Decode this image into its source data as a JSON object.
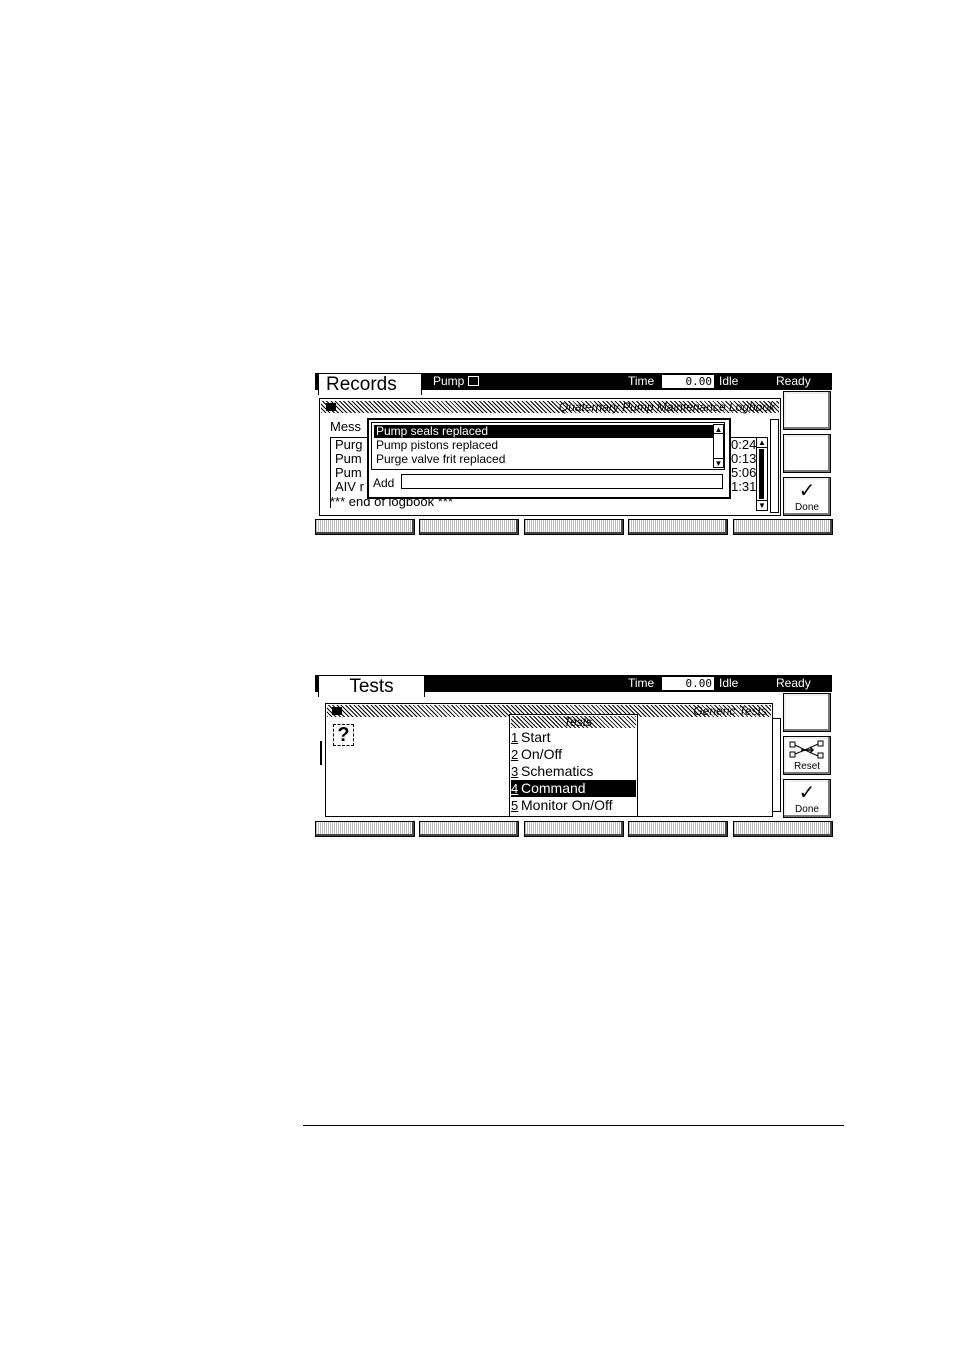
{
  "records_screen": {
    "tab_title": "Records",
    "pump_label": "Pump",
    "time_label": "Time",
    "time_value": "0.00",
    "idle_label": "Idle",
    "status": "Ready",
    "panel_title": "Quaternary Pump Maintenance Logbook",
    "column_header": "Mess",
    "background_rows": [
      "Purg",
      "Pum",
      "Pum",
      "AIV r"
    ],
    "background_times": [
      "0:24",
      "0:13",
      "5:06",
      "1:31"
    ],
    "footer_text": "*** end of logbook ***",
    "popup_items": [
      "Pump seals replaced",
      "Pump pistons replaced",
      "Purge valve frit replaced"
    ],
    "add_label": "Add",
    "add_value": "",
    "done_label": "Done"
  },
  "tests_screen": {
    "tab_title": "Tests",
    "time_label": "Time",
    "time_value": "0.00",
    "idle_label": "Idle",
    "status": "Ready",
    "panel_title": "Generic Tests",
    "help_glyph": "?",
    "menu_title": "Tests",
    "menu_items": [
      {
        "num": "1",
        "label": "Start"
      },
      {
        "num": "2",
        "label": "On/Off"
      },
      {
        "num": "3",
        "label": "Schematics"
      },
      {
        "num": "4",
        "label": "Command"
      },
      {
        "num": "5",
        "label": "Monitor On/Off"
      }
    ],
    "reset_label": "Reset",
    "done_label": "Done"
  }
}
